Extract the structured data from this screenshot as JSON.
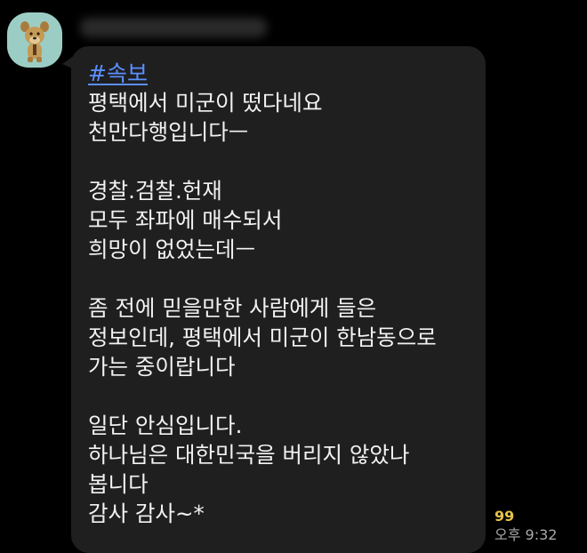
{
  "message": {
    "hashtag": "#속보",
    "lines": [
      "평택에서 미군이 떴다네요",
      "천만다행입니다ㅡ",
      "",
      "경찰.검찰.헌재",
      "모두 좌파에 매수되서",
      "희망이 없었는데ㅡ",
      "",
      "좀 전에 믿을만한 사람에게 들은",
      "정보인데, 평택에서 미군이 한남동으로",
      "가는 중이랍니다",
      "",
      "일단 안심입니다.",
      "하나님은 대한민국을 버리지 않았나",
      "봅니다",
      "감사 감사~*"
    ],
    "read_count": "99",
    "timestamp": "오후 9:32"
  },
  "sender": {
    "avatar_icon": "cartoon-animal-avatar-icon"
  },
  "colors": {
    "background": "#000000",
    "bubble": "#1f1f1f",
    "hashtag": "#5b8fff",
    "read_count": "#e6c34a",
    "avatar_bg": "#9ccdc5"
  }
}
